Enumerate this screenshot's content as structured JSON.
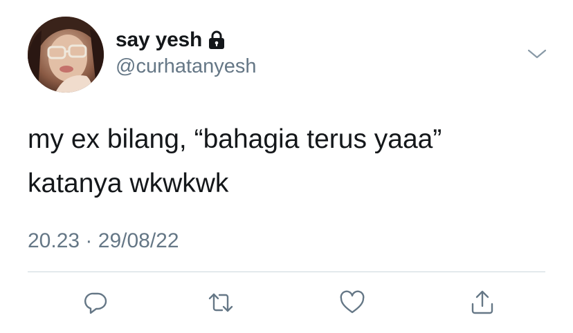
{
  "tweet": {
    "display_name": "say yesh",
    "handle": "@curhatanyesh",
    "protected_icon": "lock-icon",
    "text_line_1": "my ex bilang, “bahagia terus yaaa”",
    "text_line_2": "katanya wkwkwk",
    "time": "20.23",
    "separator": "·",
    "date": "29/08/22"
  },
  "actions": [
    {
      "icon": "reply-icon"
    },
    {
      "icon": "retweet-icon"
    },
    {
      "icon": "like-icon"
    },
    {
      "icon": "share-icon"
    }
  ],
  "colors": {
    "text": "#14171a",
    "secondary": "#657786",
    "divider": "#ccd6dd",
    "background": "#ffffff"
  }
}
